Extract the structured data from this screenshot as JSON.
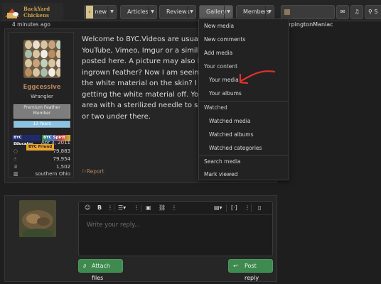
{
  "header": {
    "logo_text": "BackYard Chickens",
    "nav": [
      {
        "label": "new"
      },
      {
        "label": "Articles"
      },
      {
        "label": "Reviews"
      },
      {
        "label": "Gallery"
      },
      {
        "label": "Members"
      }
    ],
    "user": "OrpingtonManiac",
    "search_label": "S"
  },
  "post": {
    "timestamp": "4 minutes ago",
    "author": {
      "name": "Eggcessive",
      "title": "Wrangler",
      "banner_member": "Premium Feather\nMember",
      "banner_years": "13 Years",
      "badges": [
        {
          "label": "BYC Educator"
        },
        {
          "label": "BYC Spirit"
        }
      ],
      "badge_friend": "BYC Friend",
      "stats": [
        {
          "icon": "calendar-icon",
          "value": "Apr 3, 2011"
        },
        {
          "icon": "messages-icon",
          "value": "79,883"
        },
        {
          "icon": "thumbs-up-icon",
          "value": "79,954"
        },
        {
          "icon": "trophy-icon",
          "value": "1,502"
        },
        {
          "icon": "map-icon",
          "value": "southern Ohio"
        }
      ]
    },
    "body": "Welcome to BYC.Videos are usually\nYouTube, Vimeo, Imgur or a similar\nposted here. A picture may also hel\ningrown feather? Now I am seeing \nthe white material on the skin? I w\ngetting the white material off. You c\narea with a sterilized needle to see\nor two under there.",
    "report_label": "Report"
  },
  "reply": {
    "placeholder": "Write your reply...",
    "attach_label": "Attach files",
    "post_label": "Post reply"
  },
  "gallery_menu": {
    "items": [
      {
        "label": "New media",
        "type": "item"
      },
      {
        "label": "New comments",
        "type": "item"
      },
      {
        "label": "Add media",
        "type": "item"
      },
      {
        "label": "Your content",
        "type": "header"
      },
      {
        "label": "Your media",
        "type": "sub"
      },
      {
        "label": "Your albums",
        "type": "sub"
      },
      {
        "label": "Watched",
        "type": "header"
      },
      {
        "label": "Watched media",
        "type": "sub"
      },
      {
        "label": "Watched albums",
        "type": "sub"
      },
      {
        "label": "Watched categories",
        "type": "sub"
      },
      {
        "label": "Search media",
        "type": "item"
      },
      {
        "label": "Mark viewed",
        "type": "item"
      }
    ]
  },
  "colors": {
    "accent": "#b6835a",
    "green": "#3e8a4f",
    "annotation": "#e2312f"
  }
}
